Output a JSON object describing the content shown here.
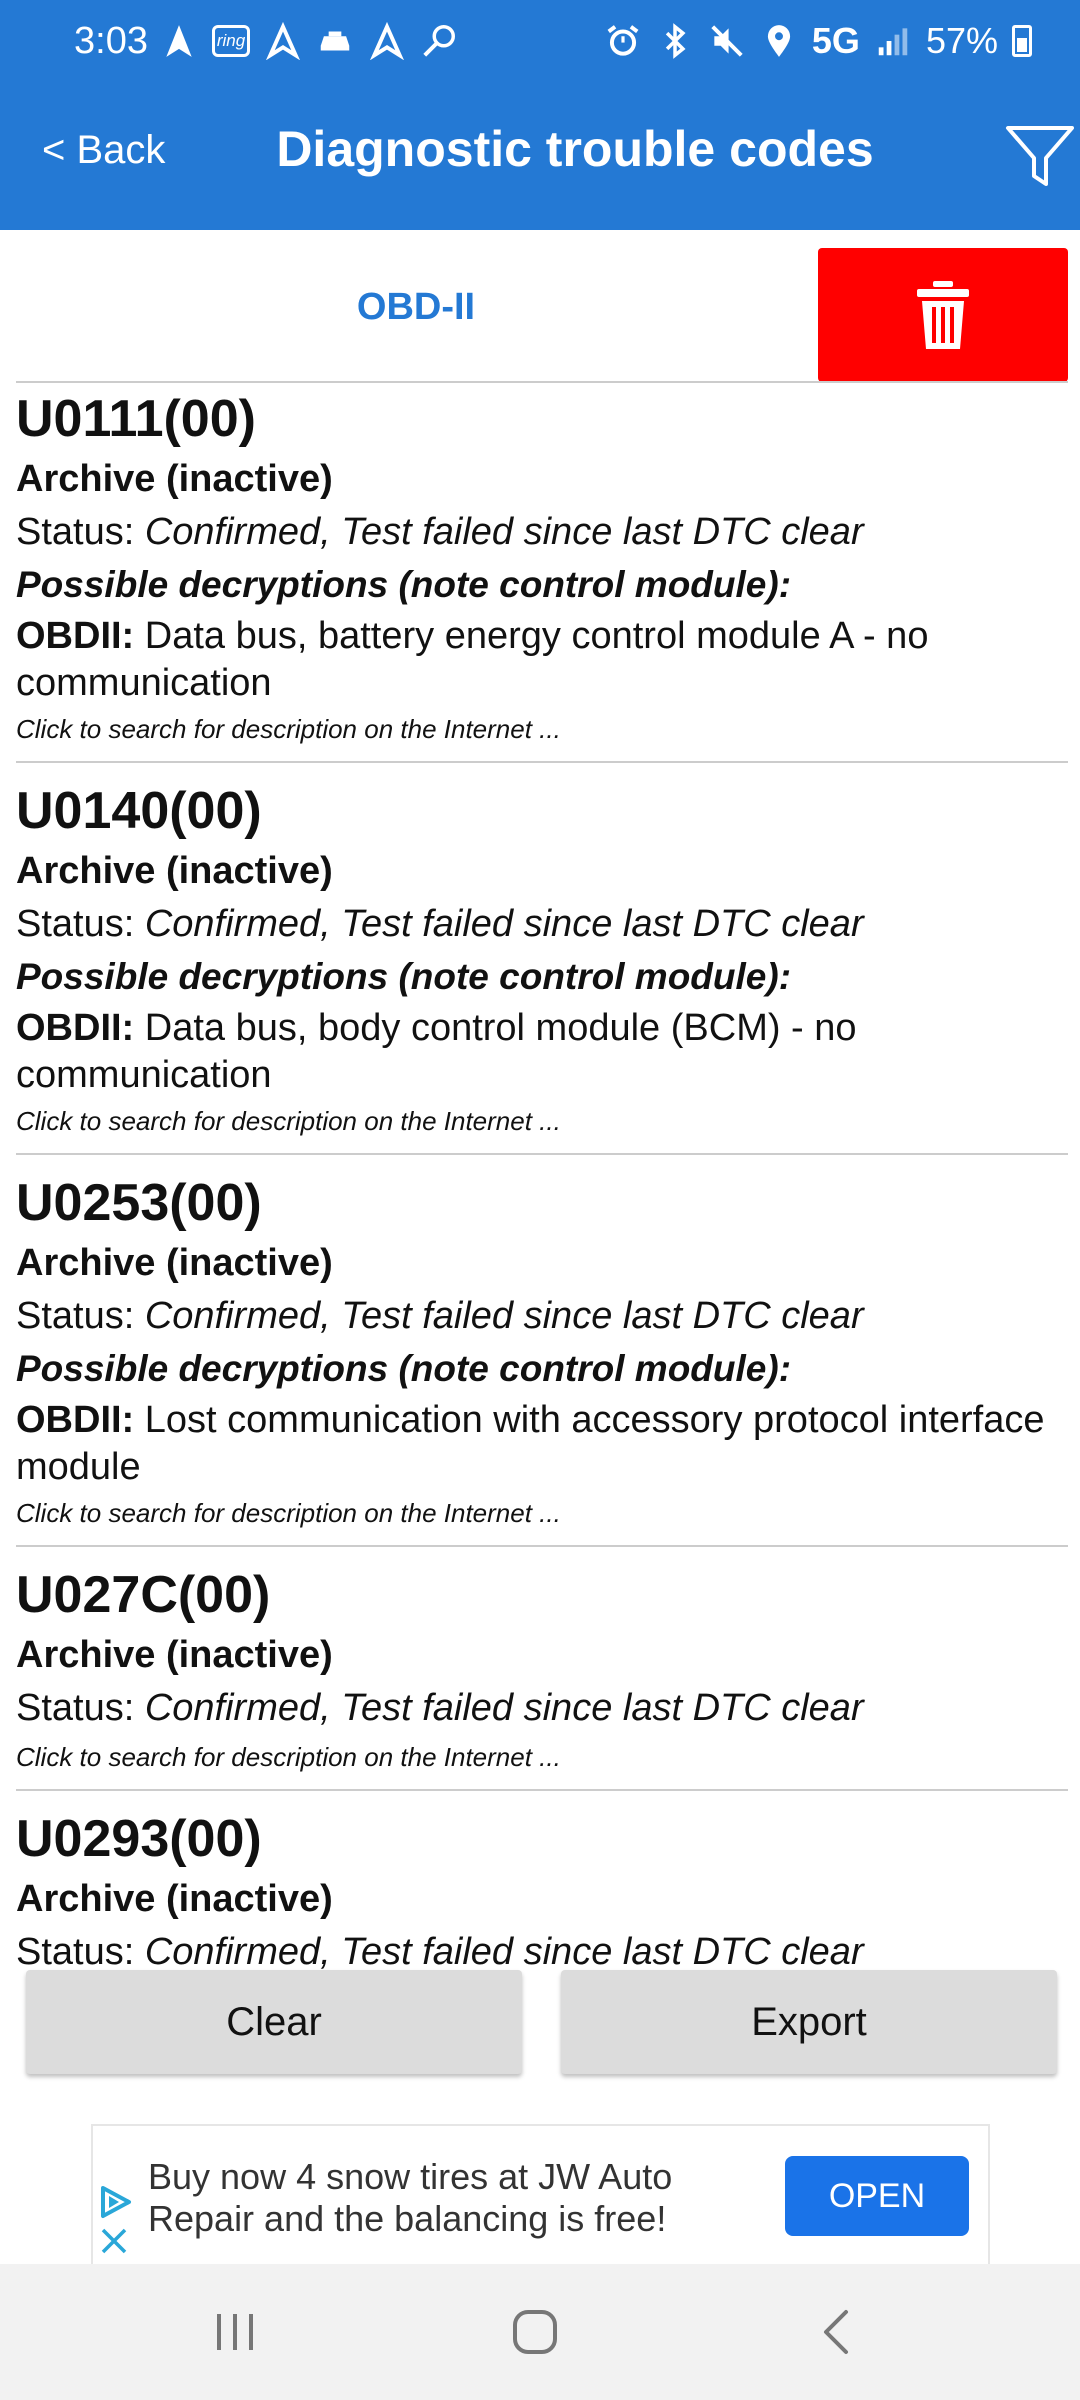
{
  "status_bar": {
    "time": "3:03",
    "network": "5G",
    "battery": "57%",
    "ring_label": "ring"
  },
  "app_bar": {
    "back_label": "< Back",
    "title": "Diagnostic trouble codes"
  },
  "tabs": {
    "obd_label": "OBD-II"
  },
  "dtcs": [
    {
      "code": "U0111(00)",
      "state": "Archive (inactive)",
      "status_prefix": "Status: ",
      "status_value": "Confirmed, Test failed since last DTC clear",
      "possible_label": "Possible decryptions (note control module):",
      "desc_prefix": "OBDII:",
      "desc_text": " Data bus, battery energy control module A - no communication",
      "search_label": "Click to search for description on the Internet ..."
    },
    {
      "code": "U0140(00)",
      "state": "Archive (inactive)",
      "status_prefix": "Status: ",
      "status_value": "Confirmed, Test failed since last DTC clear",
      "possible_label": "Possible decryptions (note control module):",
      "desc_prefix": "OBDII:",
      "desc_text": " Data bus, body control module (BCM) - no communication",
      "search_label": "Click to search for description on the Internet ..."
    },
    {
      "code": "U0253(00)",
      "state": "Archive (inactive)",
      "status_prefix": "Status: ",
      "status_value": "Confirmed, Test failed since last DTC clear",
      "possible_label": "Possible decryptions (note control module):",
      "desc_prefix": "OBDII:",
      "desc_text": " Lost communication with accessory protocol interface module",
      "search_label": "Click to search for description on the Internet ..."
    },
    {
      "code": "U027C(00)",
      "state": "Archive (inactive)",
      "status_prefix": "Status: ",
      "status_value": "Confirmed, Test failed since last DTC clear",
      "search_label": "Click to search for description on the Internet ..."
    },
    {
      "code": "U0293(00)",
      "state": "Archive (inactive)",
      "status_prefix": "Status: ",
      "status_value": "Confirmed, Test failed since last DTC clear"
    }
  ],
  "actions": {
    "clear_label": "Clear",
    "export_label": "Export"
  },
  "ad": {
    "text": "Buy now 4 snow tires at JW Auto Repair and the balancing is free!",
    "cta": "OPEN"
  },
  "colors": {
    "app_bar": "#2479d4",
    "delete": "#ff0000",
    "ad_button": "#1a73e8"
  }
}
